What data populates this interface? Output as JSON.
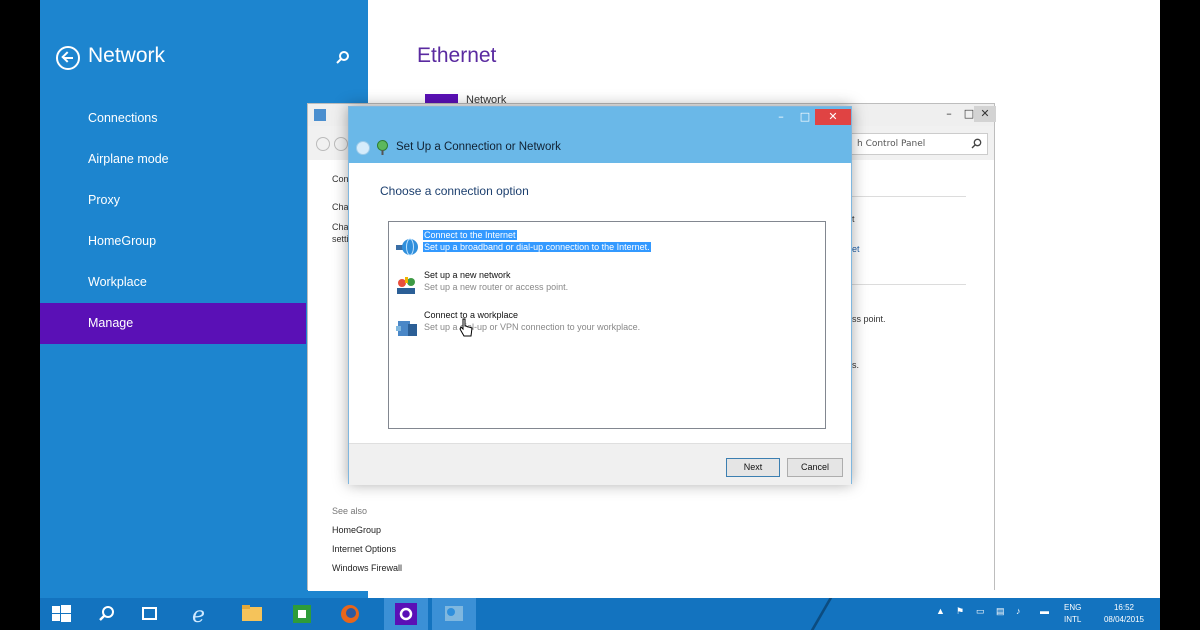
{
  "settings": {
    "title": "Network",
    "nav_items": [
      {
        "label": "Connections"
      },
      {
        "label": "Airplane mode"
      },
      {
        "label": "Proxy"
      },
      {
        "label": "HomeGroup"
      },
      {
        "label": "Workplace"
      },
      {
        "label": "Manage"
      }
    ],
    "active_item": "Manage",
    "accent_color": "#1d85cf",
    "active_color": "#5a10b6"
  },
  "ethernet": {
    "title": "Ethernet",
    "network_label": "Network"
  },
  "control_panel": {
    "search_placeholder": "h Control Panel",
    "left_fragments": [
      "Con",
      "Cha",
      "Cha",
      "setti"
    ],
    "right_fragments": [
      "t",
      "et",
      "ss point.",
      "s."
    ],
    "see_also": {
      "heading": "See also",
      "links": [
        "HomeGroup",
        "Internet Options",
        "Windows Firewall"
      ]
    }
  },
  "wizard": {
    "title": "Set Up a Connection or Network",
    "heading": "Choose a connection option",
    "options": [
      {
        "title": "Connect to the Internet",
        "description": "Set up a broadband or dial-up connection to the Internet.",
        "icon": "globe-icon",
        "selected": true
      },
      {
        "title": "Set up a new network",
        "description": "Set up a new router or access point.",
        "icon": "router-icon",
        "selected": false
      },
      {
        "title": "Connect to a workplace",
        "description": "Set up a dial-up or VPN connection to your workplace.",
        "icon": "workplace-icon",
        "selected": false
      }
    ],
    "next_label": "Next",
    "cancel_label": "Cancel"
  },
  "taskbar": {
    "apps": [
      "start",
      "search",
      "task-view",
      "internet-explorer",
      "file-explorer",
      "store",
      "firefox",
      "settings",
      "control-panel"
    ],
    "language_top": "ENG",
    "language_bottom": "INTL",
    "time": "16:52",
    "date": "08/04/2015"
  }
}
